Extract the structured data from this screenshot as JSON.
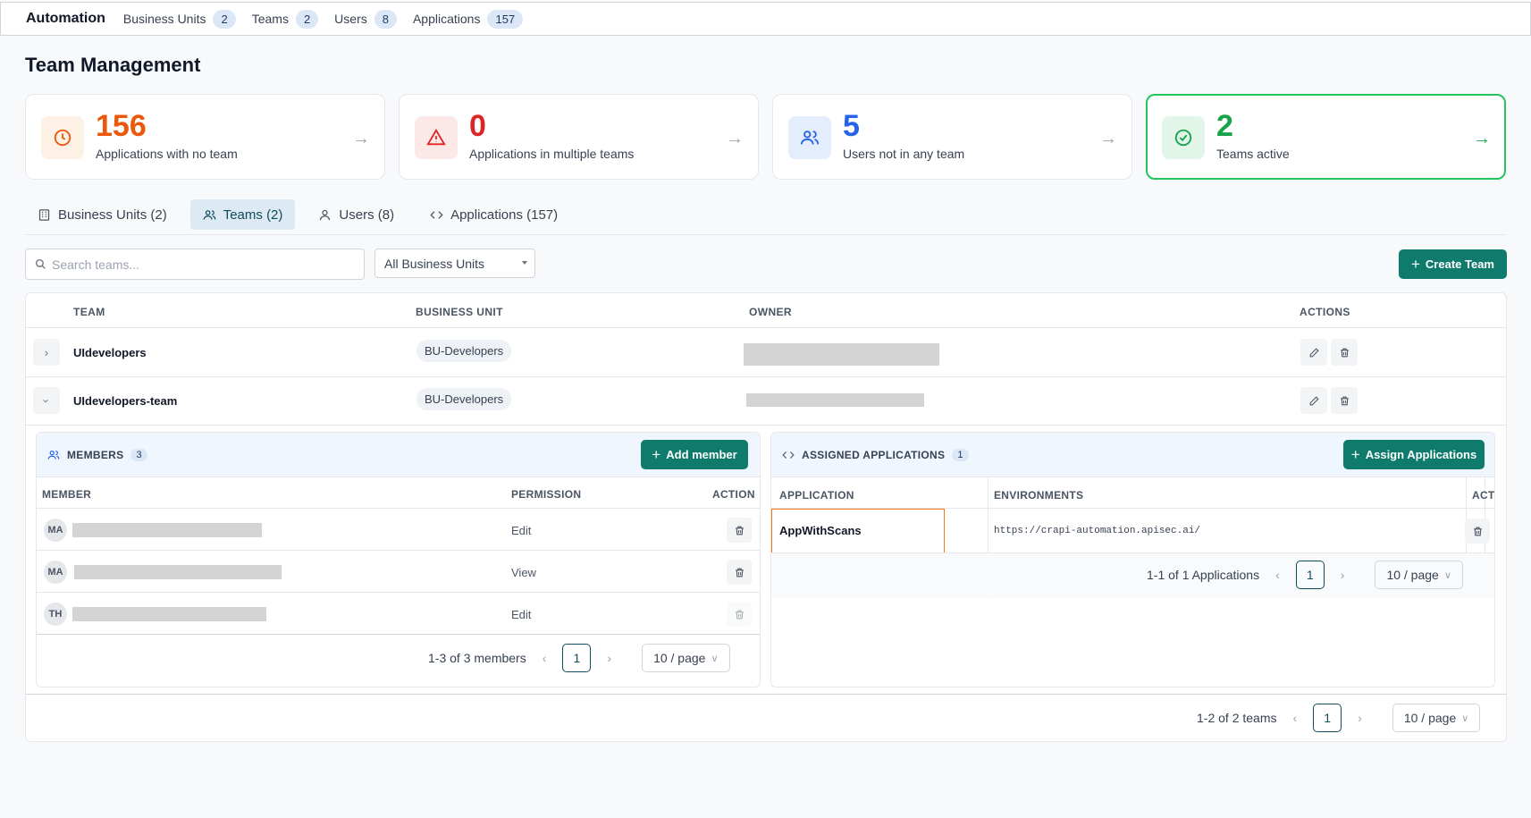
{
  "topbar": {
    "brand": "Automation",
    "nav": [
      {
        "label": "Business Units",
        "count": "2"
      },
      {
        "label": "Teams",
        "count": "2"
      },
      {
        "label": "Users",
        "count": "8"
      },
      {
        "label": "Applications",
        "count": "157"
      }
    ]
  },
  "page_title": "Team Management",
  "stats": [
    {
      "value": "156",
      "label": "Applications with no team",
      "color": "#ea580c",
      "bg": "#fdf0e4"
    },
    {
      "value": "0",
      "label": "Applications in multiple teams",
      "color": "#dc2626",
      "bg": "#fde8e8"
    },
    {
      "value": "5",
      "label": "Users not in any team",
      "color": "#2563eb",
      "bg": "#e3edfb"
    },
    {
      "value": "2",
      "label": "Teams active",
      "color": "#16a34a",
      "bg": "#e2f5e9"
    }
  ],
  "tabs": [
    {
      "label": "Business Units (2)"
    },
    {
      "label": "Teams (2)"
    },
    {
      "label": "Users (8)"
    },
    {
      "label": "Applications (157)"
    }
  ],
  "filters": {
    "search_placeholder": "Search teams...",
    "business_unit_selected": "All Business Units",
    "create_label": "Create Team"
  },
  "table": {
    "headers": {
      "team": "TEAM",
      "business_unit": "BUSINESS UNIT",
      "owner": "OWNER",
      "actions": "ACTIONS"
    },
    "rows": [
      {
        "name": "UIdevelopers",
        "business_unit": "BU-Developers"
      },
      {
        "name": "UIdevelopers-team",
        "business_unit": "BU-Developers"
      }
    ],
    "pagination": {
      "summary": "1-2 of 2 teams",
      "page": "1",
      "per_page": "10 / page"
    }
  },
  "members": {
    "title": "MEMBERS",
    "count": "3",
    "add_label": "Add member",
    "headers": {
      "member": "MEMBER",
      "permission": "PERMISSION",
      "action": "ACTION"
    },
    "rows": [
      {
        "initials": "MA",
        "permission": "Edit"
      },
      {
        "initials": "MA",
        "permission": "View"
      },
      {
        "initials": "TH",
        "permission": "Edit"
      }
    ],
    "pagination": {
      "summary": "1-3 of 3 members",
      "page": "1",
      "per_page": "10 / page"
    }
  },
  "assigned": {
    "title": "ASSIGNED APPLICATIONS",
    "count": "1",
    "assign_label": "Assign Applications",
    "headers": {
      "application": "APPLICATION",
      "environments": "ENVIRONMENTS",
      "action": "ACTION"
    },
    "rows": [
      {
        "application": "AppWithScans",
        "environment": "https://crapi-automation.apisec.ai/"
      }
    ],
    "pagination": {
      "summary": "1-1 of 1 Applications",
      "page": "1",
      "per_page": "10 / page"
    }
  }
}
